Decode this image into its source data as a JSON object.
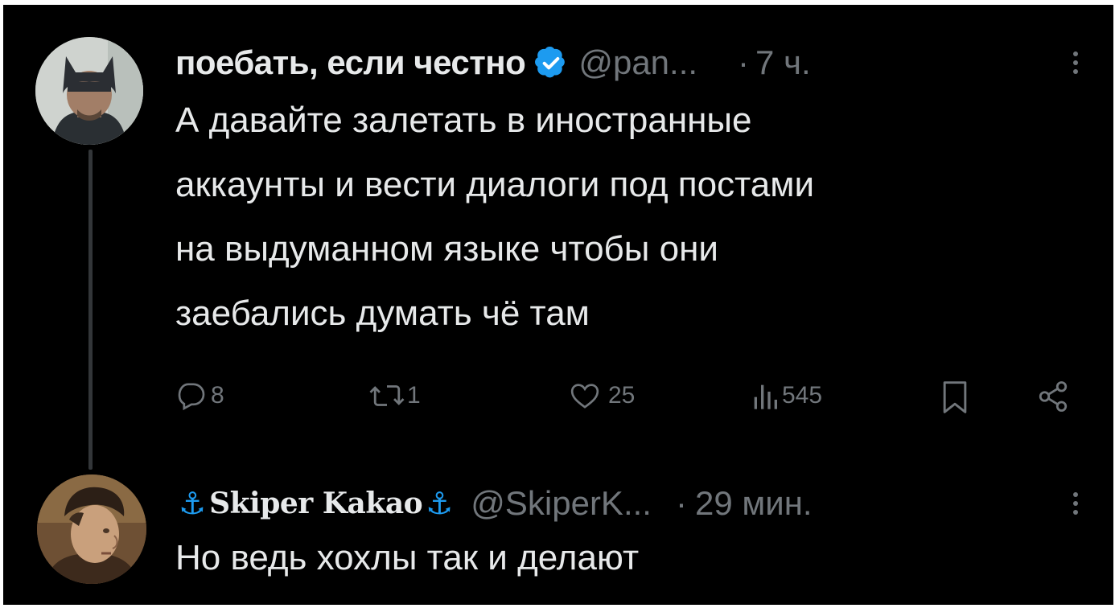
{
  "tweet1": {
    "display_name": "поебать, если честно",
    "verified": true,
    "handle": "@pan...",
    "separator": "·",
    "time": "7 ч.",
    "text": "А давайте залетать в иностранные\nаккаунты и вести диалоги под постами\nна выдуманном языке чтобы они\nзаебались думать чё там",
    "actions": {
      "replies": "8",
      "reposts": "1",
      "likes": "25",
      "views": "545"
    },
    "avatar_icon": "batman-mask-avatar"
  },
  "tweet2": {
    "anchor_left": "⚓",
    "display_name": "Skiper Kakao",
    "anchor_right": "⚓",
    "handle": "@SkiperK...",
    "separator": "·",
    "time": "29 мин.",
    "text": "Но ведь хохлы так и делают",
    "avatar_icon": "medieval-portrait-avatar"
  },
  "icons": {
    "reply": "reply-icon",
    "repost": "repost-icon",
    "like": "heart-icon",
    "views": "views-icon",
    "bookmark": "bookmark-icon",
    "share": "share-icon",
    "more": "more-icon",
    "verified": "verified-badge-icon"
  },
  "colors": {
    "background": "#000000",
    "text": "#e7e9ea",
    "muted": "#71767b",
    "accent": "#1d9bf0",
    "thread_line": "#333639"
  }
}
